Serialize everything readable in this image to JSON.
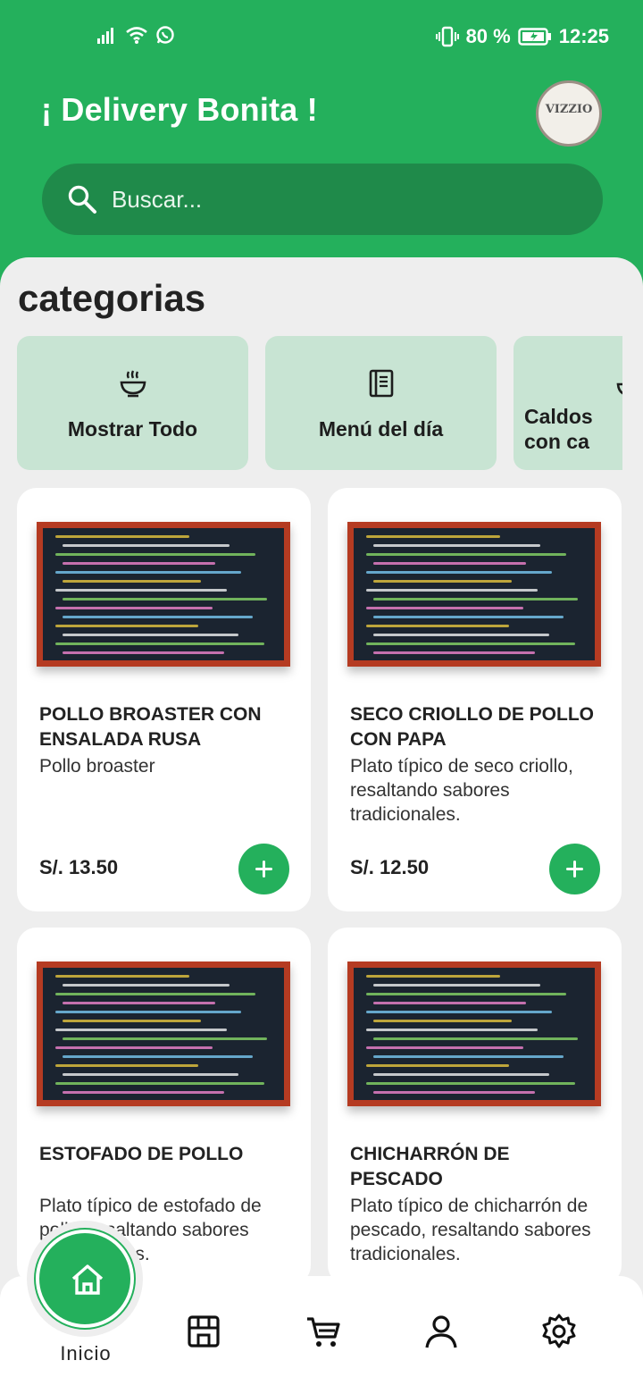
{
  "status_bar": {
    "battery": "80 %",
    "time": "12:25"
  },
  "header": {
    "title": "¡ Delivery Bonita !",
    "avatar_logo_text": "VIZZIO",
    "search_placeholder": "Buscar..."
  },
  "categories": {
    "title": "categorias",
    "items": [
      {
        "label": "Mostrar Todo",
        "icon": "bowl-icon"
      },
      {
        "label": "Menú del día",
        "icon": "menu-book-icon"
      },
      {
        "label": "Caldos con ca",
        "icon": "soup-icon"
      }
    ]
  },
  "products": [
    {
      "name": "POLLO BROASTER CON ENSALADA RUSA",
      "description": "Pollo broaster",
      "price": "S/. 13.50"
    },
    {
      "name": "SECO CRIOLLO DE POLLO CON PAPA",
      "description": "Plato típico de seco criollo, resaltando sabores tradicionales.",
      "price": "S/. 12.50"
    },
    {
      "name": "ESTOFADO DE POLLO",
      "description": "Plato típico de estofado de pollo, resaltando sabores tradicionales.",
      "price": ""
    },
    {
      "name": "CHICHARRÓN DE PESCADO",
      "description": "Plato típico de chicharrón de pescado, resaltando sabores tradicionales.",
      "price": ""
    }
  ],
  "bottom_nav": {
    "home_label": "Inicio",
    "items": [
      "home-icon",
      "store-icon",
      "cart-icon",
      "user-icon",
      "settings-icon"
    ]
  },
  "colors": {
    "brand_green": "#24b05c",
    "search_bg": "#1f8a4a",
    "category_bg": "#c8e4d3"
  }
}
